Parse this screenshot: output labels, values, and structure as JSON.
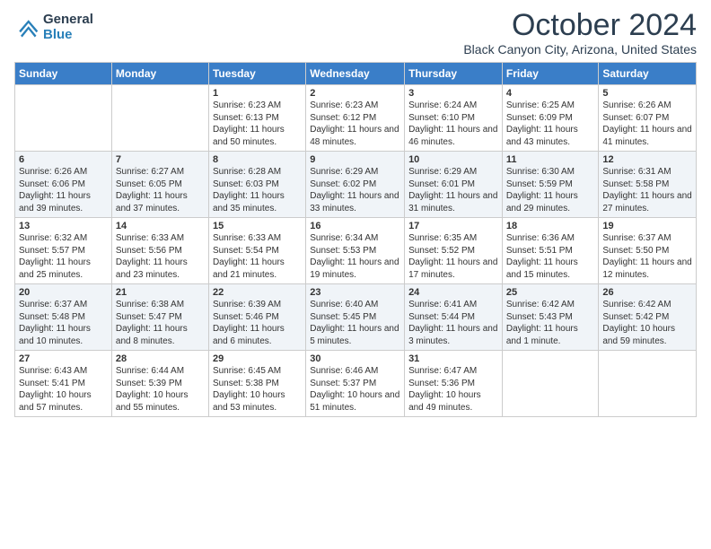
{
  "logo": {
    "general": "General",
    "blue": "Blue"
  },
  "title": "October 2024",
  "location": "Black Canyon City, Arizona, United States",
  "days_of_week": [
    "Sunday",
    "Monday",
    "Tuesday",
    "Wednesday",
    "Thursday",
    "Friday",
    "Saturday"
  ],
  "weeks": [
    [
      {
        "day": "",
        "info": ""
      },
      {
        "day": "",
        "info": ""
      },
      {
        "day": "1",
        "info": "Sunrise: 6:23 AM\nSunset: 6:13 PM\nDaylight: 11 hours and 50 minutes."
      },
      {
        "day": "2",
        "info": "Sunrise: 6:23 AM\nSunset: 6:12 PM\nDaylight: 11 hours and 48 minutes."
      },
      {
        "day": "3",
        "info": "Sunrise: 6:24 AM\nSunset: 6:10 PM\nDaylight: 11 hours and 46 minutes."
      },
      {
        "day": "4",
        "info": "Sunrise: 6:25 AM\nSunset: 6:09 PM\nDaylight: 11 hours and 43 minutes."
      },
      {
        "day": "5",
        "info": "Sunrise: 6:26 AM\nSunset: 6:07 PM\nDaylight: 11 hours and 41 minutes."
      }
    ],
    [
      {
        "day": "6",
        "info": "Sunrise: 6:26 AM\nSunset: 6:06 PM\nDaylight: 11 hours and 39 minutes."
      },
      {
        "day": "7",
        "info": "Sunrise: 6:27 AM\nSunset: 6:05 PM\nDaylight: 11 hours and 37 minutes."
      },
      {
        "day": "8",
        "info": "Sunrise: 6:28 AM\nSunset: 6:03 PM\nDaylight: 11 hours and 35 minutes."
      },
      {
        "day": "9",
        "info": "Sunrise: 6:29 AM\nSunset: 6:02 PM\nDaylight: 11 hours and 33 minutes."
      },
      {
        "day": "10",
        "info": "Sunrise: 6:29 AM\nSunset: 6:01 PM\nDaylight: 11 hours and 31 minutes."
      },
      {
        "day": "11",
        "info": "Sunrise: 6:30 AM\nSunset: 5:59 PM\nDaylight: 11 hours and 29 minutes."
      },
      {
        "day": "12",
        "info": "Sunrise: 6:31 AM\nSunset: 5:58 PM\nDaylight: 11 hours and 27 minutes."
      }
    ],
    [
      {
        "day": "13",
        "info": "Sunrise: 6:32 AM\nSunset: 5:57 PM\nDaylight: 11 hours and 25 minutes."
      },
      {
        "day": "14",
        "info": "Sunrise: 6:33 AM\nSunset: 5:56 PM\nDaylight: 11 hours and 23 minutes."
      },
      {
        "day": "15",
        "info": "Sunrise: 6:33 AM\nSunset: 5:54 PM\nDaylight: 11 hours and 21 minutes."
      },
      {
        "day": "16",
        "info": "Sunrise: 6:34 AM\nSunset: 5:53 PM\nDaylight: 11 hours and 19 minutes."
      },
      {
        "day": "17",
        "info": "Sunrise: 6:35 AM\nSunset: 5:52 PM\nDaylight: 11 hours and 17 minutes."
      },
      {
        "day": "18",
        "info": "Sunrise: 6:36 AM\nSunset: 5:51 PM\nDaylight: 11 hours and 15 minutes."
      },
      {
        "day": "19",
        "info": "Sunrise: 6:37 AM\nSunset: 5:50 PM\nDaylight: 11 hours and 12 minutes."
      }
    ],
    [
      {
        "day": "20",
        "info": "Sunrise: 6:37 AM\nSunset: 5:48 PM\nDaylight: 11 hours and 10 minutes."
      },
      {
        "day": "21",
        "info": "Sunrise: 6:38 AM\nSunset: 5:47 PM\nDaylight: 11 hours and 8 minutes."
      },
      {
        "day": "22",
        "info": "Sunrise: 6:39 AM\nSunset: 5:46 PM\nDaylight: 11 hours and 6 minutes."
      },
      {
        "day": "23",
        "info": "Sunrise: 6:40 AM\nSunset: 5:45 PM\nDaylight: 11 hours and 5 minutes."
      },
      {
        "day": "24",
        "info": "Sunrise: 6:41 AM\nSunset: 5:44 PM\nDaylight: 11 hours and 3 minutes."
      },
      {
        "day": "25",
        "info": "Sunrise: 6:42 AM\nSunset: 5:43 PM\nDaylight: 11 hours and 1 minute."
      },
      {
        "day": "26",
        "info": "Sunrise: 6:42 AM\nSunset: 5:42 PM\nDaylight: 10 hours and 59 minutes."
      }
    ],
    [
      {
        "day": "27",
        "info": "Sunrise: 6:43 AM\nSunset: 5:41 PM\nDaylight: 10 hours and 57 minutes."
      },
      {
        "day": "28",
        "info": "Sunrise: 6:44 AM\nSunset: 5:39 PM\nDaylight: 10 hours and 55 minutes."
      },
      {
        "day": "29",
        "info": "Sunrise: 6:45 AM\nSunset: 5:38 PM\nDaylight: 10 hours and 53 minutes."
      },
      {
        "day": "30",
        "info": "Sunrise: 6:46 AM\nSunset: 5:37 PM\nDaylight: 10 hours and 51 minutes."
      },
      {
        "day": "31",
        "info": "Sunrise: 6:47 AM\nSunset: 5:36 PM\nDaylight: 10 hours and 49 minutes."
      },
      {
        "day": "",
        "info": ""
      },
      {
        "day": "",
        "info": ""
      }
    ]
  ]
}
